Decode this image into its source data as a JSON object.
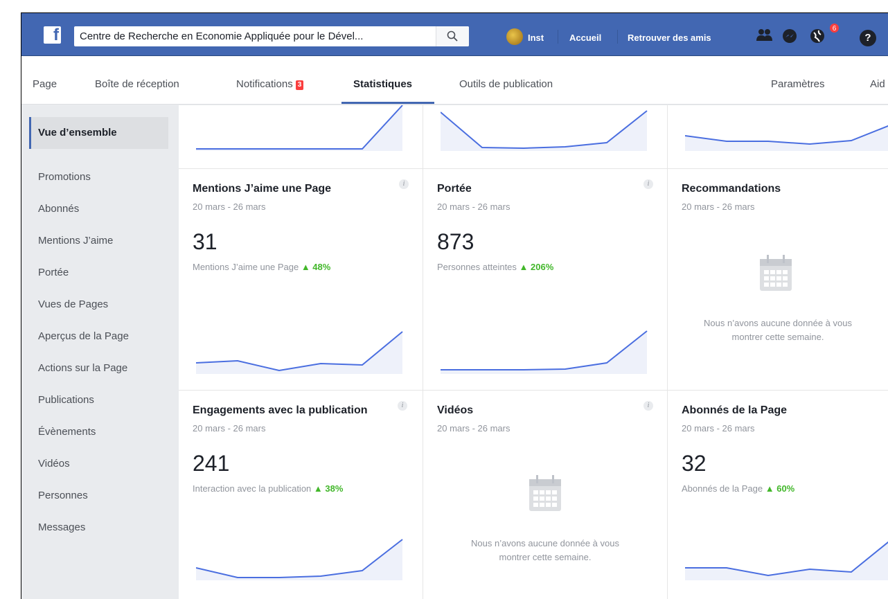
{
  "topbar": {
    "logo_letter": "f",
    "search_value": "Centre de Recherche en Economie Appliquée pour le Dével...",
    "profile_name": "Inst",
    "links": [
      "Accueil",
      "Retrouver des amis"
    ],
    "notification_count": "6",
    "help_label": "?"
  },
  "pagenav": {
    "items": [
      "Page",
      "Boîte de réception",
      "Notifications",
      "Statistiques",
      "Outils de publication",
      "Paramètres",
      "Aid"
    ],
    "notifications_badge": "3",
    "active": "Statistiques"
  },
  "sidebar": {
    "active": "Vue d’ensemble",
    "items": [
      "Promotions",
      "Abonnés",
      "Mentions J’aime",
      "Portée",
      "Vues de Pages",
      "Aperçus de la Page",
      "Actions sur la Page",
      "Publications",
      "Évènements",
      "Vidéos",
      "Personnes",
      "Messages"
    ]
  },
  "cards": {
    "row1": {
      "title": "Mentions J’aime une Page",
      "date": "20 mars - 26 mars",
      "value": "31",
      "subtitle": "Mentions J’aime une Page",
      "delta": "▲ 48%"
    },
    "row2": {
      "title": "Portée",
      "date": "20 mars - 26 mars",
      "value": "873",
      "subtitle": "Personnes atteintes",
      "delta": "▲ 206%"
    },
    "row3": {
      "title": "Recommandations",
      "date": "20 mars - 26 mars",
      "nodata_line1": "Nous n’avons aucune donnée à vous",
      "nodata_line2": "montrer cette semaine."
    },
    "row4": {
      "title": "Engagements avec la publication",
      "date": "20 mars - 26 mars",
      "value": "241",
      "subtitle": "Interaction avec la publication",
      "delta": "▲ 38%"
    },
    "row5": {
      "title": "Vidéos",
      "date": "20 mars - 26 mars",
      "nodata_line1": "Nous n’avons aucune donnée à vous",
      "nodata_line2": "montrer cette semaine."
    },
    "row6": {
      "title": "Abonnés de la Page",
      "date": "20 mars - 26 mars",
      "value": "32",
      "subtitle": "Abonnés de la Page",
      "delta": "▲ 60%"
    }
  },
  "colors": {
    "brand_blue": "#4267b2",
    "spark_line": "#4a6ee0",
    "delta_green": "#42b72a",
    "badge_red": "#fa3e3e"
  }
}
